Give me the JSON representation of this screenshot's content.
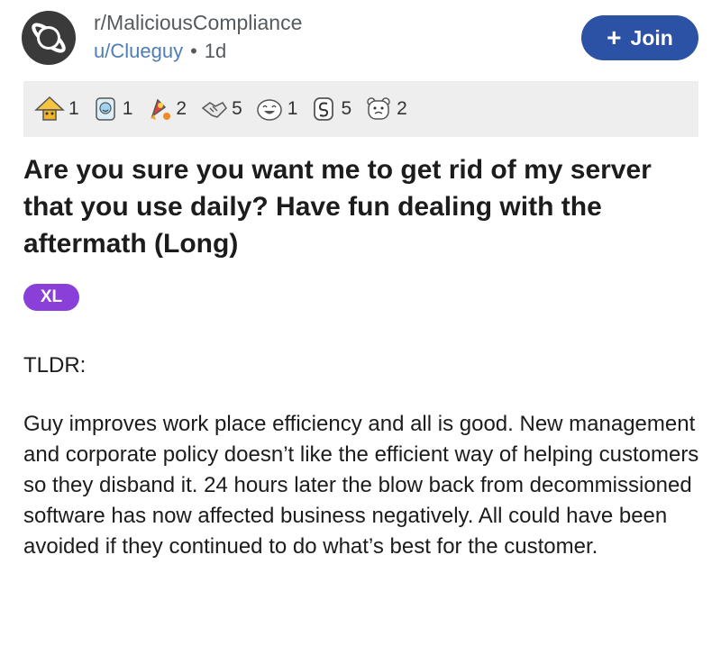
{
  "post": {
    "subreddit": "r/MaliciousCompliance",
    "author": "u/Clueguy",
    "separator": "•",
    "age": "1d",
    "join_label": "Join",
    "title": "Are you sure you want me to get rid of my server that you use daily? Have fun dealing with the aftermath (Long)",
    "flair": "XL",
    "body_heading": "TLDR:",
    "body": "Guy improves work place efficiency and all is good. New management and corporate policy doesn’t like the efficient way of helping customers so they disband it. 24 hours later the blow back from decommissioned software has now affected business negatively. All could have been avoided if they continued to do what’s best for the customer."
  },
  "awards": [
    {
      "icon": "helpful-award-icon",
      "count": "1"
    },
    {
      "icon": "wholesome-award-icon",
      "count": "1"
    },
    {
      "icon": "rocket-like-award-icon",
      "count": "2"
    },
    {
      "icon": "handshake-award-icon",
      "count": "5"
    },
    {
      "icon": "laughing-award-icon",
      "count": "1"
    },
    {
      "icon": "snek-award-icon",
      "count": "5"
    },
    {
      "icon": "bear-face-award-icon",
      "count": "2"
    }
  ],
  "colors": {
    "join_button": "#2c52a6",
    "flair": "#8b3fd9",
    "author_link": "#4f7db5",
    "award_bar": "#eeeeee"
  }
}
